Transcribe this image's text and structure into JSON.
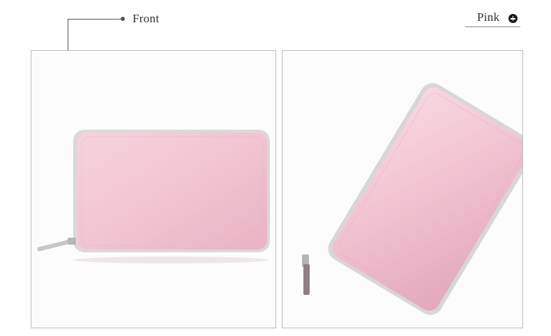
{
  "callout": {
    "label": "Front"
  },
  "color_option": {
    "label": "Pink",
    "icon": "plus-circle-icon"
  },
  "product": {
    "colors": {
      "leather": "#f2c6d3",
      "leather_shadow": "#e3a9bb",
      "zipper": "#d9d6d8"
    },
    "views": [
      "front-view",
      "angled-view"
    ]
  }
}
